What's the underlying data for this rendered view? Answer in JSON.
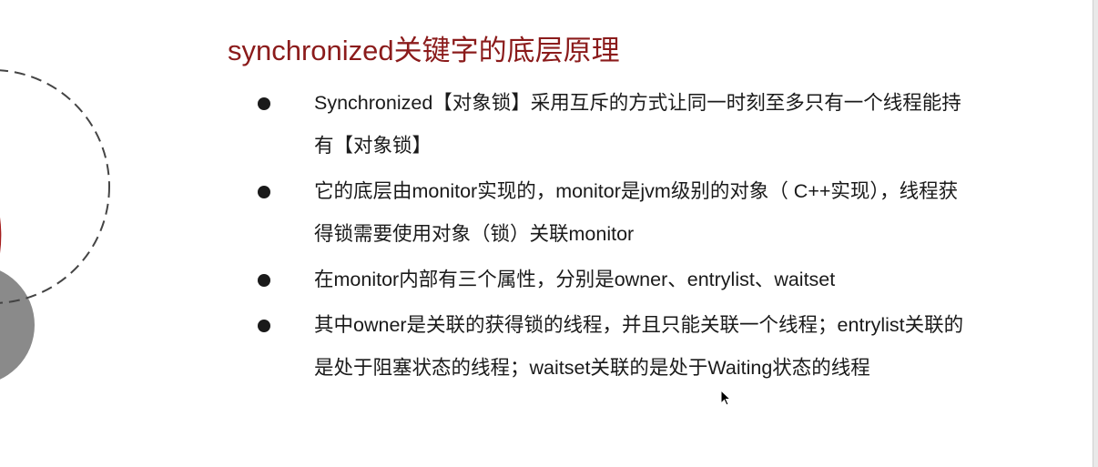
{
  "slide": {
    "title": "synchronized关键字的底层原理",
    "bullets": [
      {
        "text": "Synchronized【对象锁】采用互斥的方式让同一时刻至多只有一个线程能持有【对象锁】"
      },
      {
        "text": "它的底层由monitor实现的，monitor是jvm级别的对象（ C++实现），线程获得锁需要使用对象（锁）关联monitor"
      },
      {
        "text": "在monitor内部有三个属性，分别是owner、entrylist、waitset"
      },
      {
        "text": "其中owner是关联的获得锁的线程，并且只能关联一个线程；entrylist关联的是处于阻塞状态的线程；waitset关联的是处于Waiting状态的线程"
      }
    ]
  },
  "colors": {
    "title": "#8b1b1b",
    "text": "#1a1a1a",
    "accent_red": "#a51e1e",
    "gray_circle": "#8a8a8a",
    "dashed_circle": "#444444"
  },
  "icons": {
    "cursor": "mouse-pointer-icon"
  }
}
